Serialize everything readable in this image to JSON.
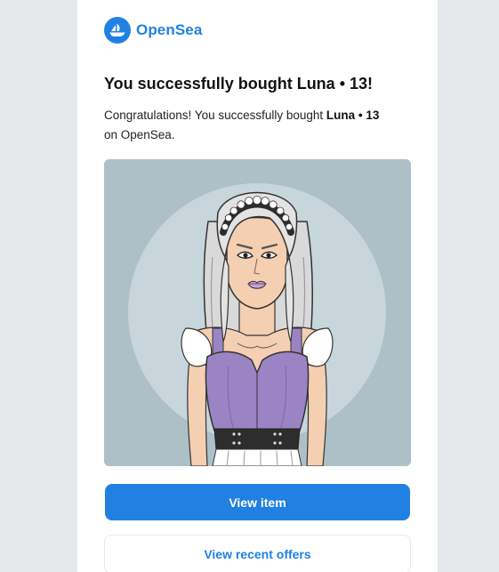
{
  "brand": {
    "name": "OpenSea",
    "color": "#2081e2"
  },
  "message": {
    "title": "You successfully bought Luna • 13!",
    "intro": "Congratulations! You successfully bought ",
    "item_name": "Luna • 13",
    "outro": "on OpenSea."
  },
  "nft": {
    "icon": "nft-portrait-illustration",
    "background": "#adc0c6"
  },
  "actions": {
    "view_item": "View item",
    "view_offers": "View recent offers"
  }
}
